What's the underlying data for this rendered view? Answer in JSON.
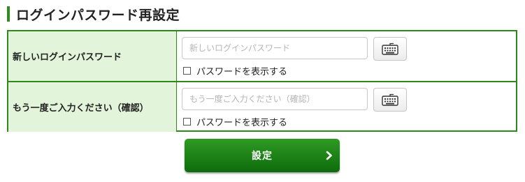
{
  "page": {
    "title": "ログインパスワード再設定"
  },
  "form": {
    "rows": [
      {
        "label": "新しいログインパスワード",
        "placeholder": "新しいログインパスワード",
        "value": "",
        "show_password_label": "パスワードを表示する",
        "show_password_checked": false,
        "keyboard_icon": "keyboard-icon"
      },
      {
        "label": "もう一度ご入力ください（確認）",
        "placeholder": "もう一度ご入力ください（確認）",
        "value": "",
        "show_password_label": "パスワードを表示する",
        "show_password_checked": false,
        "keyboard_icon": "keyboard-icon"
      }
    ]
  },
  "submit": {
    "label": "設定",
    "icon": "chevron-right-icon"
  },
  "colors": {
    "accent": "#2e8b1e",
    "label_bg": "#e2f4d9",
    "button_green": "#1b8217"
  }
}
